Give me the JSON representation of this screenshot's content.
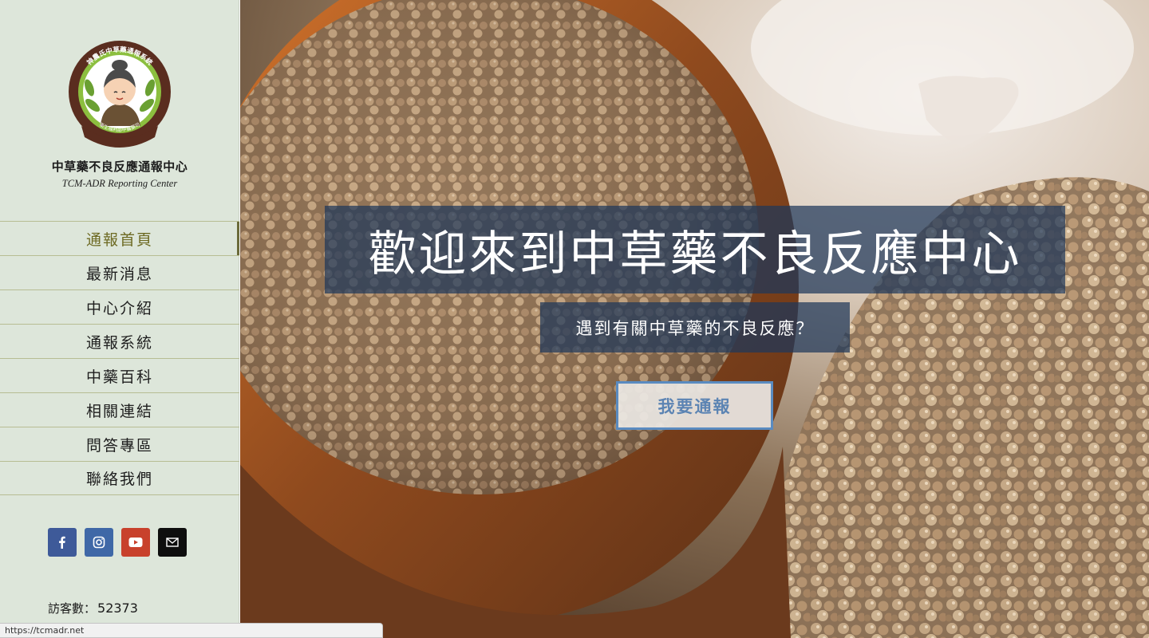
{
  "brand": {
    "logo_ring_top": "神農氏中草藥通報系統",
    "logo_ring_bottom": "衛生福利部中醫藥司",
    "name_zh": "中草藥不良反應通報中心",
    "name_en": "TCM-ADR Reporting Center"
  },
  "nav": {
    "items": [
      {
        "label": "通報首頁",
        "active": true
      },
      {
        "label": "最新消息",
        "active": false
      },
      {
        "label": "中心介紹",
        "active": false
      },
      {
        "label": "通報系統",
        "active": false
      },
      {
        "label": "中藥百科",
        "active": false
      },
      {
        "label": "相關連結",
        "active": false
      },
      {
        "label": "問答專區",
        "active": false
      },
      {
        "label": "聯絡我們",
        "active": false
      }
    ]
  },
  "social": [
    {
      "name": "facebook-icon",
      "color": "#3e5a99"
    },
    {
      "name": "instagram-icon",
      "color": "#3f68a7"
    },
    {
      "name": "youtube-icon",
      "color": "#c8412c"
    },
    {
      "name": "mail-icon",
      "color": "#0e0e0e"
    }
  ],
  "visitor": {
    "label": "訪客數：",
    "count": "52373"
  },
  "hero": {
    "headline": "歡迎來到中草藥不良反應中心",
    "subline": "遇到有關中草藥的不良反應？",
    "cta": "我要通報"
  },
  "status_bar": {
    "url": "https://tcmadr.net"
  },
  "colors": {
    "sidebar_bg": "#dde6da",
    "nav_active": "#6d6a23",
    "overlay": "#1e375a",
    "cta_border": "#5a8bc0"
  }
}
